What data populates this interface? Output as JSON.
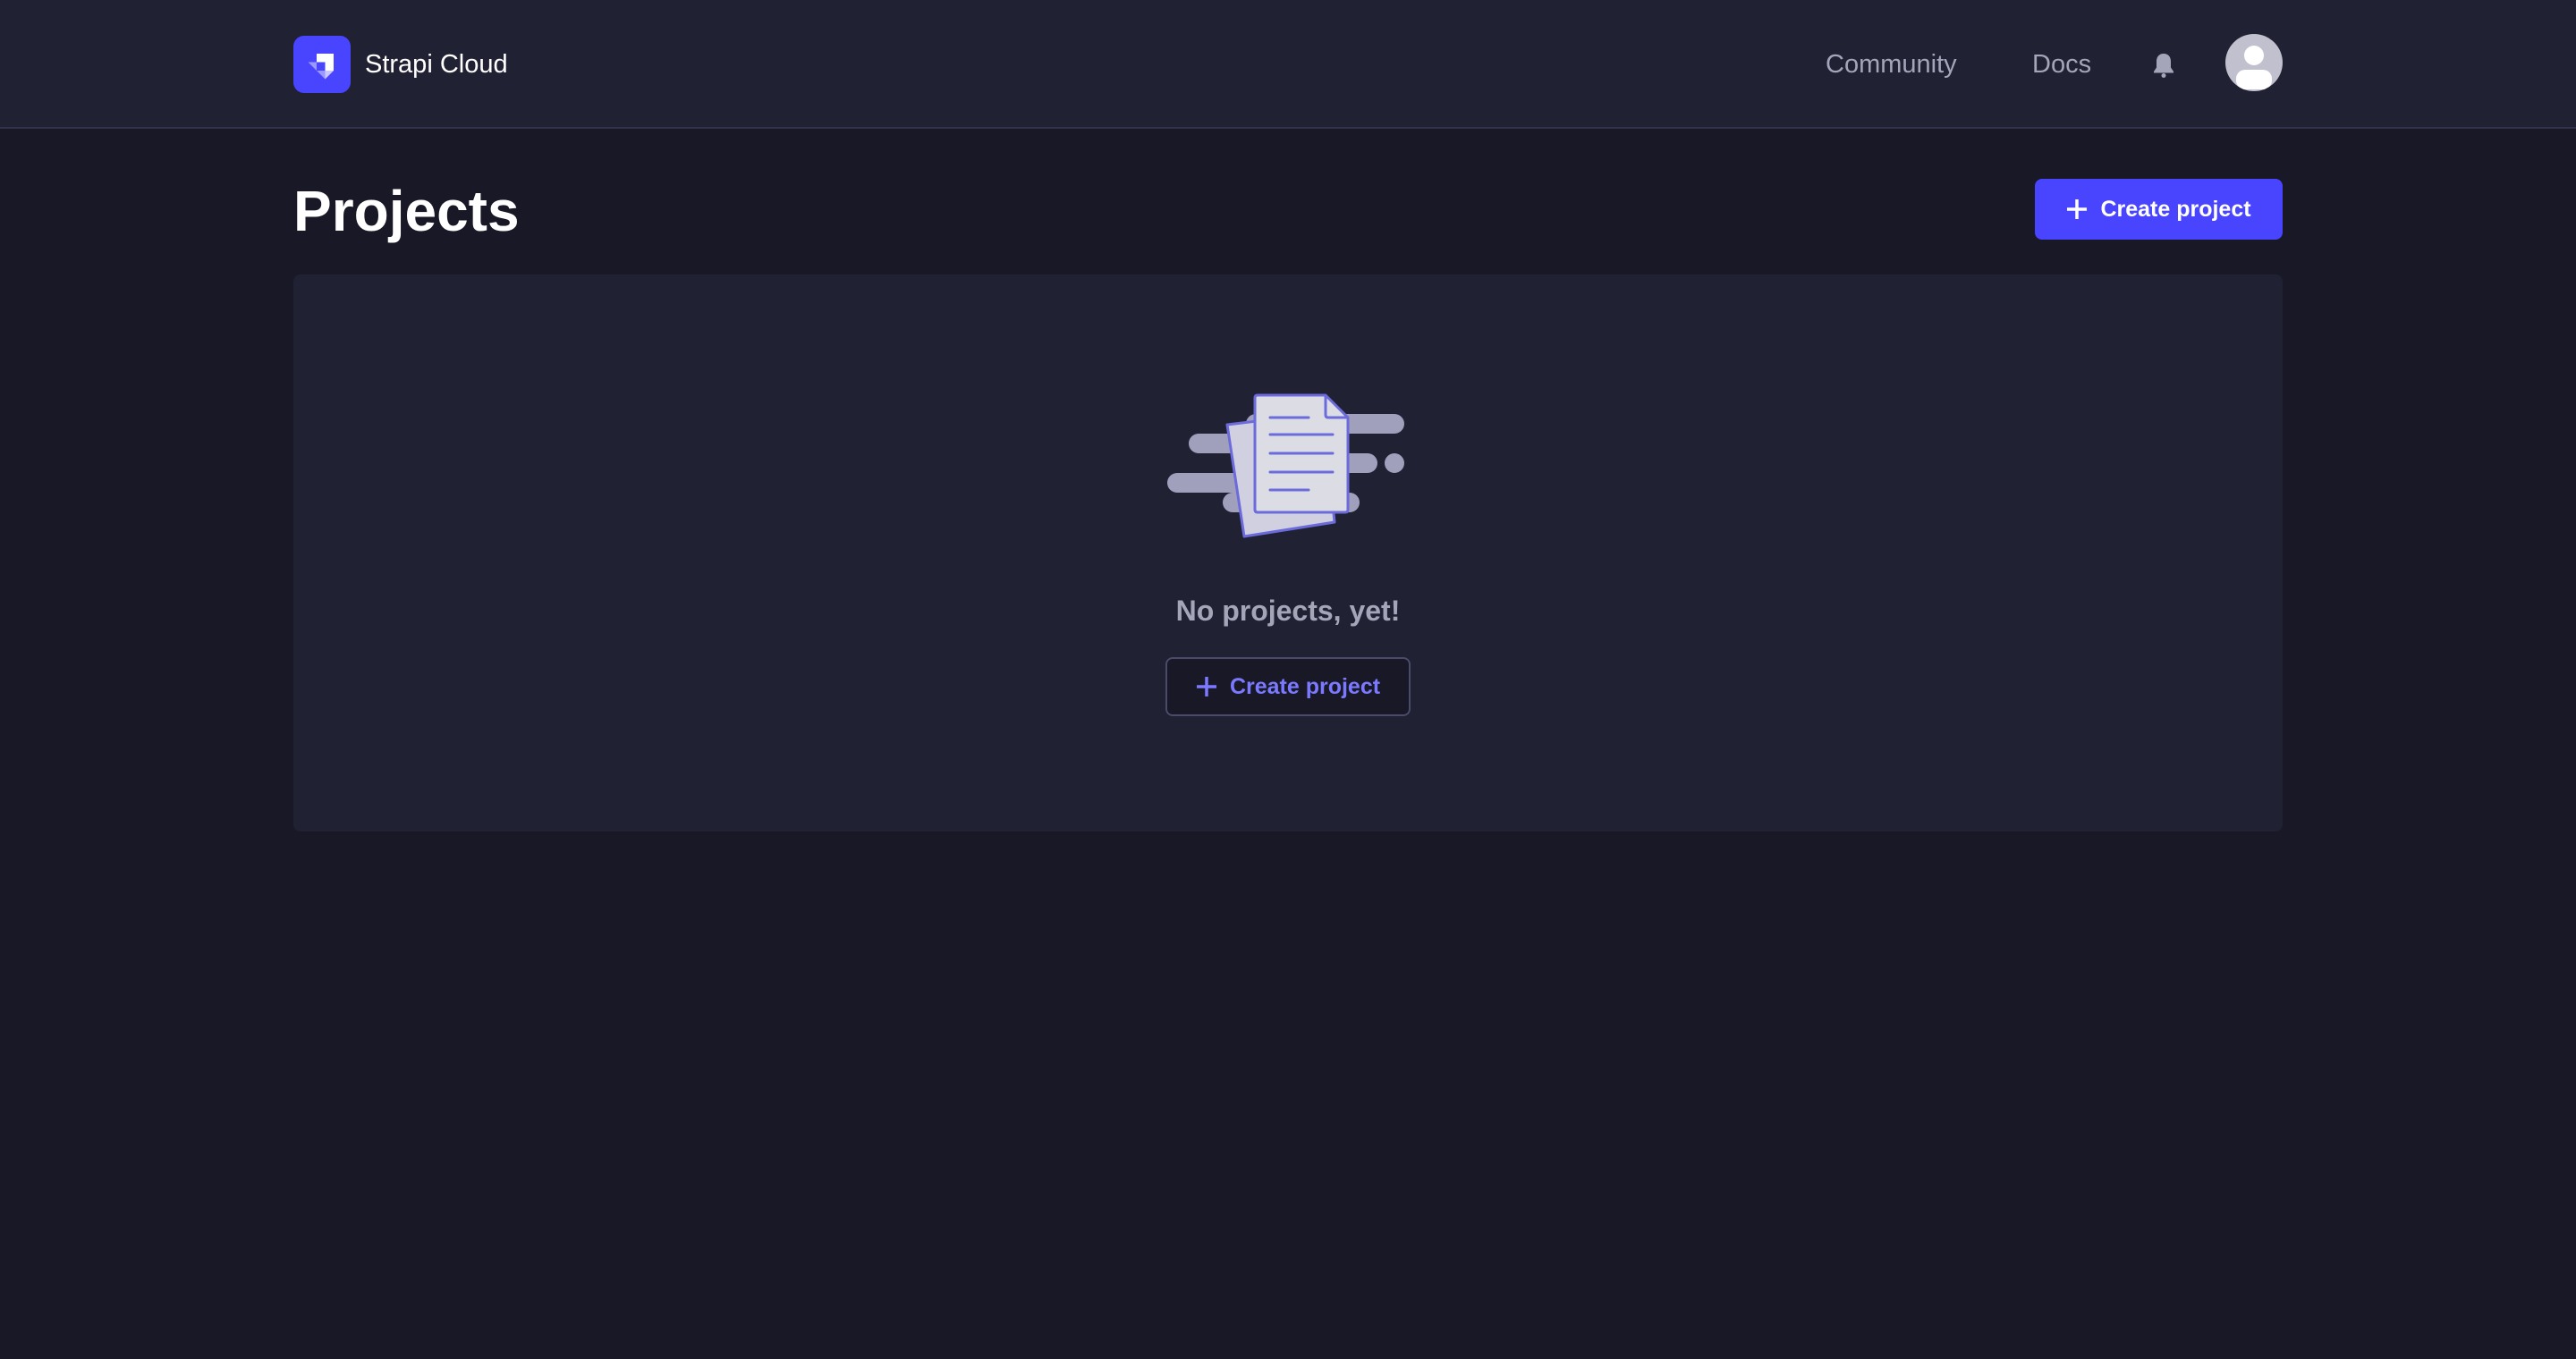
{
  "header": {
    "brand": "Strapi Cloud",
    "nav": [
      "Community",
      "Docs"
    ],
    "icons": {
      "notifications": "bell-icon",
      "avatar": "user-avatar-icon"
    }
  },
  "page": {
    "title": "Projects",
    "create_label": "Create project"
  },
  "empty_state": {
    "message": "No projects, yet!",
    "create_label": "Create project"
  },
  "colors": {
    "accent": "#4945ff",
    "background": "#181826",
    "surface": "#212134",
    "muted_text": "#a5a5ba",
    "link": "#7b79ff"
  }
}
